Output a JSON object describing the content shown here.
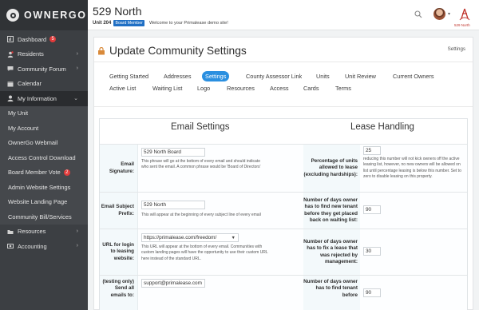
{
  "app": {
    "logo_text": "OWNERGO"
  },
  "sidebar": {
    "items": [
      {
        "label": "Dashboard",
        "icon": "dashboard-icon",
        "badge": "5",
        "arrow": false
      },
      {
        "label": "Residents",
        "icon": "residents-icon",
        "badge": "",
        "arrow": true
      },
      {
        "label": "Community Forum",
        "icon": "forum-icon",
        "badge": "",
        "arrow": true
      },
      {
        "label": "Calendar",
        "icon": "calendar-icon",
        "badge": "",
        "arrow": false
      },
      {
        "label": "My Information",
        "icon": "user-icon",
        "badge": "",
        "arrow": true
      },
      {
        "label": "My Unit",
        "sub": true
      },
      {
        "label": "My Account",
        "sub": true
      },
      {
        "label": "OwnerGo Webmail",
        "sub": true
      },
      {
        "label": "Access Control Download",
        "sub": true
      },
      {
        "label": "Board Member Vote",
        "sub": true,
        "badge": "2"
      },
      {
        "label": "Admin Website Settings",
        "sub": true
      },
      {
        "label": "Website Landing Page",
        "sub": true
      },
      {
        "label": "Community Bill/Services",
        "sub": true
      },
      {
        "label": "Resources",
        "icon": "resources-icon",
        "badge": "",
        "arrow": true
      },
      {
        "label": "Accounting",
        "icon": "accounting-icon",
        "badge": "",
        "arrow": true
      }
    ]
  },
  "header": {
    "property_name": "529 North",
    "unit": "Unit 204",
    "role_badge": "Board Member",
    "welcome": "Welcome to your Primalease demo site!",
    "brand_label": "529 North"
  },
  "page": {
    "title": "Update Community Settings",
    "breadcrumb": "Settings"
  },
  "tabs": {
    "row1": [
      "Getting Started",
      "Addresses",
      "Settings",
      "County Assessor Link",
      "Units",
      "Unit Review",
      "Current Owners"
    ],
    "row2": [
      "Active List",
      "Waiting List",
      "Logo",
      "Resources",
      "Access",
      "Cards",
      "Terms"
    ],
    "selected": "Settings"
  },
  "email_settings": {
    "heading": "Email Settings",
    "rows": [
      {
        "label": "Email Signature:",
        "value": "529 North Board",
        "help": "This phrase will go at the bottom of every email and should indicate who sent the email. A common phrase would be 'Board of Directors'"
      },
      {
        "label": "Email Subject Prefix:",
        "value": "529 North",
        "help": "This will appear at the beginning of every subject line of every email"
      },
      {
        "label": "URL for login to leasing website:",
        "value": "https://primalease.com/freedom/",
        "help": "This URL will appear at the bottom of every email. Communities with custom landing pages will have the opportunity to use their custom URL here instead of the standard URL."
      },
      {
        "label": "(testing only) Send all emails to:",
        "value": "support@primalease.com",
        "help": ""
      }
    ]
  },
  "lease_handling": {
    "heading": "Lease Handling",
    "rows": [
      {
        "label": "Percentage of units allowed to lease (excluding hardships):",
        "value": "25",
        "help": "reducing this number will not kick owners off the active leasing list, however, no new owners will be allowed on list until percentage leasing is below this number. Set to zero to disable leasing on this property."
      },
      {
        "label": "Number of days owner has to find new tenant before they get placed back on waiting list:",
        "value": "90",
        "help": ""
      },
      {
        "label": "Number of days owner has to fix a lease that was rejected by management:",
        "value": "30",
        "help": ""
      },
      {
        "label": "Number of days owner has to find tenant before",
        "value": "90",
        "help": ""
      }
    ]
  },
  "colors": {
    "sidebar": "#3c3f43",
    "accent": "#2a8fe0",
    "badge": "#e23b3b",
    "role_badge": "#1f6fc4"
  }
}
